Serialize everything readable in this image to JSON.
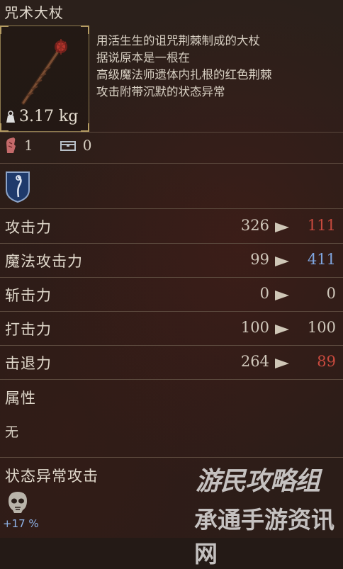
{
  "item": {
    "name": "咒术大杖",
    "weight": "3.17 kg",
    "description": [
      "用活生生的诅咒荆棘制成的大杖",
      "据说原本是一根在",
      "高级魔法师遗体内扎根的红色荆棘",
      "攻击附带沉默的状态异常"
    ]
  },
  "counts": {
    "hand_icon": "hand-icon",
    "hand_value": "1",
    "chest_icon": "chest-icon",
    "chest_value": "0"
  },
  "badge_icon": "magic-shield-icon",
  "stats": [
    {
      "label": "攻击力",
      "base": "326",
      "new": "111",
      "new_color": "#c94a3e"
    },
    {
      "label": "魔法攻击力",
      "base": "99",
      "new": "411",
      "new_color": "#7fa6e0"
    },
    {
      "label": "斩击力",
      "base": "0",
      "new": "0",
      "new_color": "#d0c8bb"
    },
    {
      "label": "打击力",
      "base": "100",
      "new": "100",
      "new_color": "#d0c8bb"
    },
    {
      "label": "击退力",
      "base": "264",
      "new": "89",
      "new_color": "#c94a3e"
    }
  ],
  "attribute": {
    "label": "属性",
    "value": "无"
  },
  "status_effect": {
    "label": "状态异常攻击",
    "icon": "skull-mask-icon",
    "value": "+17 %"
  },
  "watermark": {
    "line1": "游民攻略组",
    "line2": "承通手游资讯网"
  }
}
